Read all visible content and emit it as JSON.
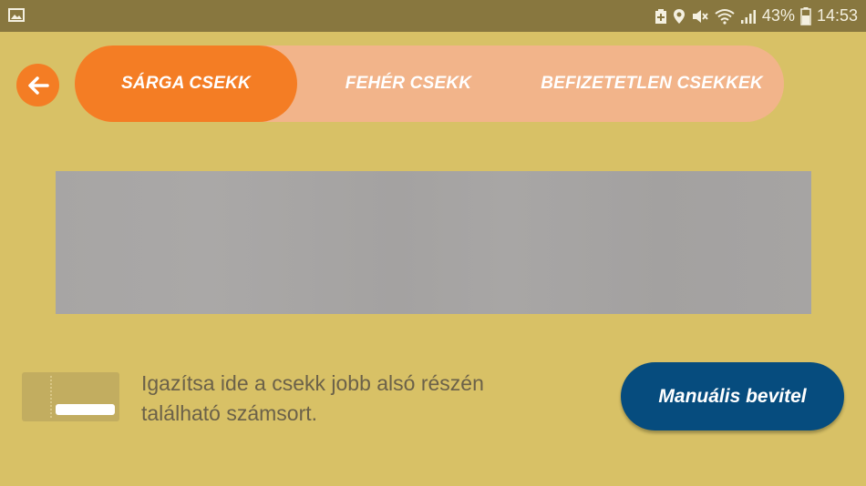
{
  "status_bar": {
    "battery_percent": "43%",
    "time": "14:53",
    "icons": [
      "image-icon",
      "battery-saver-icon",
      "location-icon",
      "mute-icon",
      "wifi-icon",
      "signal-icon",
      "battery-icon"
    ]
  },
  "nav": {
    "back_icon": "arrow-left-icon",
    "tabs": [
      {
        "label": "SÁRGA CSEKK",
        "active": true
      },
      {
        "label": "FEHÉR CSEKK",
        "active": false
      },
      {
        "label": "BEFIZETETLEN CSEKKEK",
        "active": false
      }
    ]
  },
  "hint": {
    "line1": "Igazítsa ide a csekk jobb alsó részén",
    "line2": "található számsort."
  },
  "manual_button": {
    "label": "Manuális bevitel"
  },
  "colors": {
    "background": "#d8c166",
    "status_bar": "#88773f",
    "accent_orange": "#f47d24",
    "tab_inactive": "#f2b48a",
    "button_blue": "#064c7e"
  }
}
